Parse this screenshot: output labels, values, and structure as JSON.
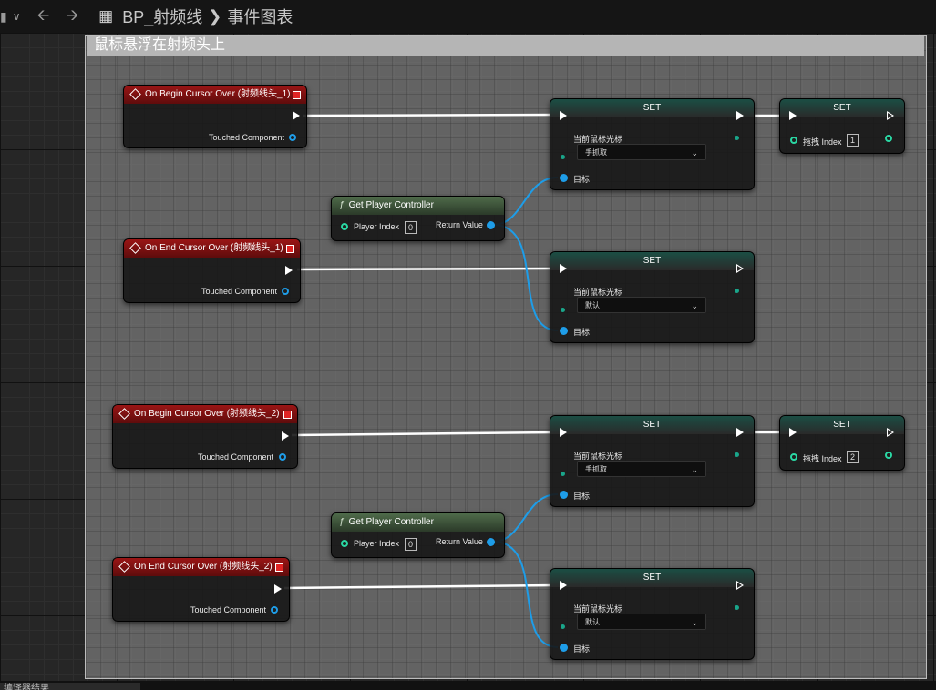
{
  "breadcrumb": {
    "blueprint": "BP_射频线",
    "graph": "事件图表"
  },
  "comment": {
    "title": "鼠标悬浮在射频头上"
  },
  "status": {
    "tab_label": "编译器结果"
  },
  "labels": {
    "touched_component": "Touched Component",
    "player_index": "Player Index",
    "return_value": "Return Value",
    "target": "目标",
    "current_cursor": "当前鼠标光标",
    "set": "SET",
    "drag_index": "拖拽 Index",
    "get_player_controller": "Get Player Controller"
  },
  "events": [
    {
      "title": "On Begin Cursor Over (射频线头_1)"
    },
    {
      "title": "On End Cursor Over (射频线头_1)"
    },
    {
      "title": "On Begin Cursor Over (射频线头_2)"
    },
    {
      "title": "On End Cursor Over (射频线头_2)"
    }
  ],
  "get_pc": [
    {
      "player_index": "0"
    },
    {
      "player_index": "0"
    }
  ],
  "set_cursor": [
    {
      "value": "手抓取"
    },
    {
      "value": "默认"
    },
    {
      "value": "手抓取"
    },
    {
      "value": "默认"
    }
  ],
  "set_index": [
    {
      "value": "1"
    },
    {
      "value": "2"
    }
  ],
  "colors": {
    "exec_wire": "#ffffff",
    "object_wire": "#1e9de8",
    "event_header": "#9a1515",
    "function_header": "#4f6b4a",
    "set_header": "#1b4e44"
  }
}
